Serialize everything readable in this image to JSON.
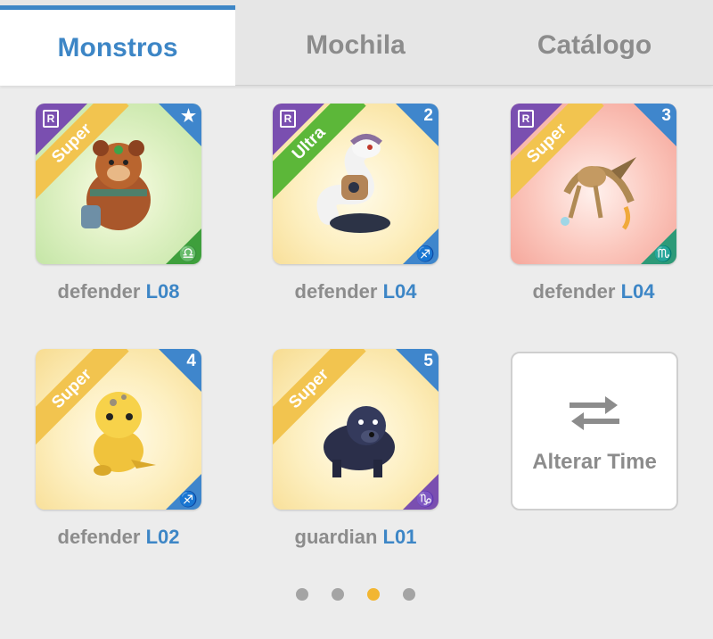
{
  "tabs": [
    {
      "label": "Monstros",
      "active": true
    },
    {
      "label": "Mochila",
      "active": false
    },
    {
      "label": "Catálogo",
      "active": false
    }
  ],
  "monsters": [
    {
      "rarity": "Super",
      "slot": "★",
      "sign": "♎",
      "name": "defender",
      "level": "L08",
      "bg": "green"
    },
    {
      "rarity": "Ultra",
      "slot": "2",
      "sign": "♐",
      "name": "defender",
      "level": "L04",
      "bg": "yellow"
    },
    {
      "rarity": "Super",
      "slot": "3",
      "sign": "♏",
      "name": "defender",
      "level": "L04",
      "bg": "red"
    },
    {
      "rarity": "Super",
      "slot": "4",
      "sign": "♐",
      "name": "defender",
      "level": "L02",
      "bg": "yellow"
    },
    {
      "rarity": "Super",
      "slot": "5",
      "sign": "♑",
      "name": "guardian",
      "level": "L01",
      "bg": "yellow"
    }
  ],
  "badge_letter": "R",
  "switch_team": {
    "label": "Alterar Time",
    "icon": "swap-arrows-icon"
  },
  "pager": {
    "pages": 4,
    "current": 3
  },
  "colors": {
    "accent": "#3d86c6",
    "active_dot": "#f2b632",
    "rarity_badge": "#7a4fb0"
  }
}
